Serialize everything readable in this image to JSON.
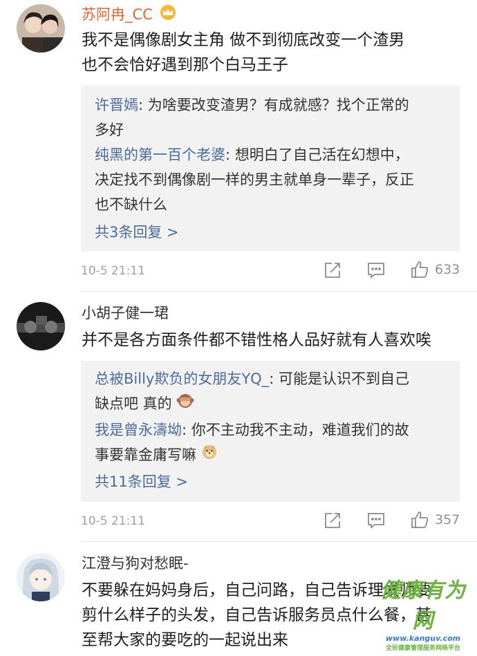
{
  "comments": [
    {
      "username": "苏阿冉_CC",
      "lines": [
        "我不是偶像剧女主角  做不到彻底改变一个渣男",
        "也不会恰好遇到那个白马王子"
      ],
      "replies": [
        {
          "name": "许晋嫣",
          "sep": ": ",
          "text": "为啥要改变渣男？有成就感？找个正常的",
          "cont": "多好"
        },
        {
          "name": "纯黑的第一百个老婆",
          "sep": ": ",
          "text": "想明白了自己活在幻想中，",
          "cont": "决定找不到偶像剧一样的男主就单身一辈子，反正",
          "cont2": "也不缺什么"
        }
      ],
      "more_replies": "共3条回复 >",
      "timestamp": "10-5 21:11",
      "likes": "633"
    },
    {
      "username": "小胡子健一珺",
      "lines": [
        "并不是各方面条件都不错性格人品好就有人喜欢唉"
      ],
      "replies": [
        {
          "name": "总被Billy欺负的女朋友YQ_",
          "sep": ": ",
          "text": "可能是认识不到自己",
          "cont": "缺点吧 真的"
        },
        {
          "name": "我是曾永濤坳",
          "sep": ": ",
          "text": "你不主动我不主动，难道我们的故",
          "cont": "事要靠金庸写嘛"
        }
      ],
      "more_replies": "共11条回复 >",
      "timestamp": "10-5 21:11",
      "likes": "357"
    },
    {
      "username": "江澄与狗对愁眠-",
      "lines": [
        "不要躲在妈妈身后，自己问路，自己告诉理发师要",
        "剪什么样子的头发，自己告诉服务员点什么餐，甚",
        "至帮大家的要吃的一起说出来"
      ]
    }
  ],
  "icons": {
    "vip": "crown-icon",
    "monkey": "see-no-evil-monkey-emoji",
    "doge": "doge-emoji",
    "share": "share-icon",
    "comment": "comment-icon",
    "like": "thumbs-up-icon"
  },
  "colors": {
    "username_vip": "#e8632b",
    "username": "#333333",
    "reply_name": "#4c6c9c",
    "reply_bg": "#f2f2f2",
    "meta": "#a0a0a0"
  },
  "watermark": {
    "title": "健康有为网",
    "url": "www.kanguv.com",
    "subtitle": "全民健康管理服务网络平台"
  }
}
